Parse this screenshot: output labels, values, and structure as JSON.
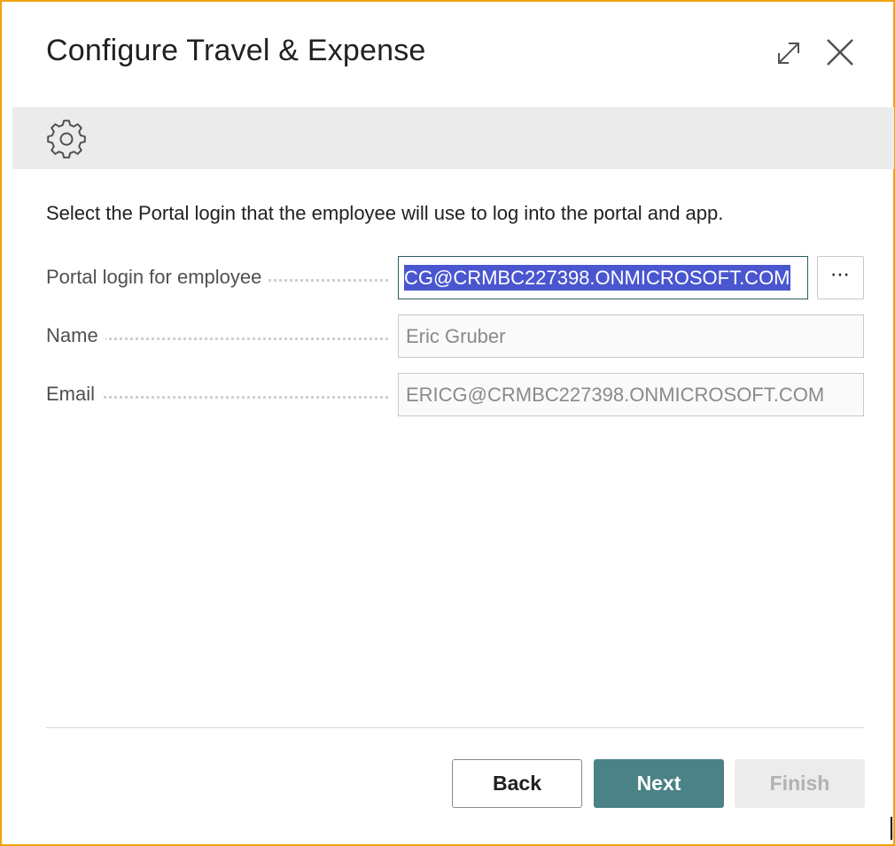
{
  "dialog": {
    "title": "Configure Travel & Expense",
    "accent_border_color": "#f0a30a",
    "header_icons": [
      "expand-icon",
      "close-icon"
    ],
    "banner_icon": "gear-icon"
  },
  "instruction": "Select the Portal login that the employee will use to log into the portal and app.",
  "fields": {
    "portal_login": {
      "label": "Portal login for employee",
      "value": "CG@CRMBC227398.ONMICROSOFT.COM",
      "lookup_label": "⋯"
    },
    "name": {
      "label": "Name",
      "value": "Eric Gruber"
    },
    "email": {
      "label": "Email",
      "value": "ERICG@CRMBC227398.ONMICROSOFT.COM"
    }
  },
  "buttons": {
    "back": "Back",
    "next": "Next",
    "finish": "Finish"
  },
  "colors": {
    "primary": "#4a8286",
    "selection": "#4a56cf",
    "banner": "#ebebeb"
  }
}
